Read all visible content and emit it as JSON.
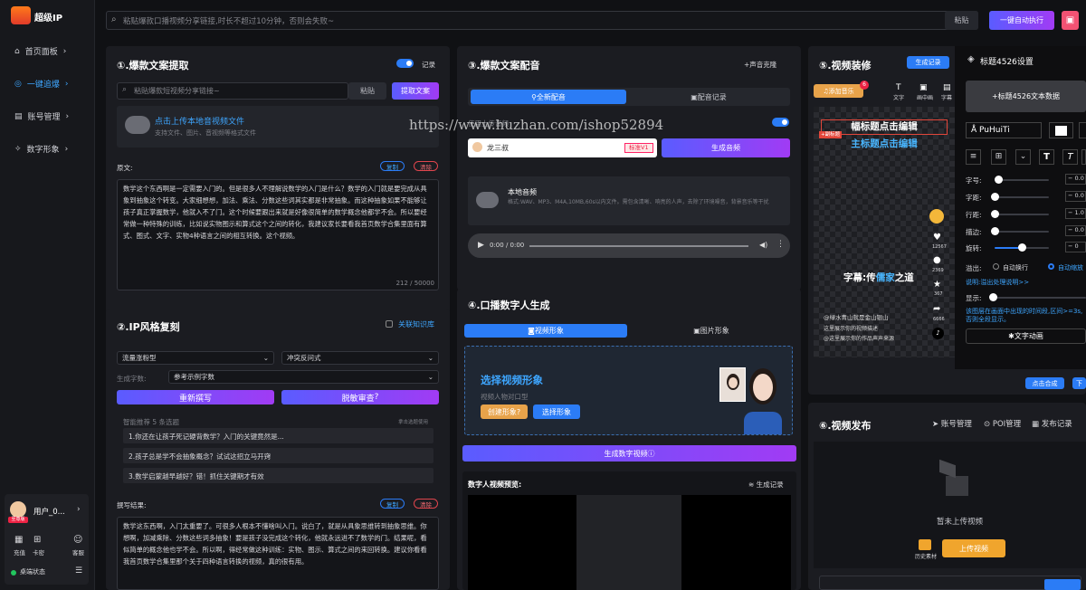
{
  "app": {
    "name": "超级IP"
  },
  "sidebar": {
    "items": [
      {
        "label": "首页面板"
      },
      {
        "label": "一键追爆"
      },
      {
        "label": "账号管理"
      },
      {
        "label": "数字形象"
      }
    ],
    "user": {
      "name": "用户_0...",
      "badge": "至尊版"
    },
    "quick": [
      {
        "label": "充值"
      },
      {
        "label": "卡密"
      },
      {
        "label": "客服"
      }
    ],
    "status": "桌端状态"
  },
  "topbar": {
    "placeholder": "粘贴爆款口播视频分享链接,时长不超过10分钟，否则会失败~",
    "paste": "粘贴",
    "run": "一键自动执行"
  },
  "p1": {
    "title": "①.爆款文案提取",
    "record": "记录",
    "link_placeholder": "粘贴爆款短视频分享链接~",
    "paste": "粘贴",
    "extract": "提取文案",
    "upload": "点击上传本地音视频文件",
    "upload_hint": "支持文件、图片、音视频等格式文件",
    "orig_label": "原文:",
    "copy": "复制",
    "clear": "清除",
    "orig_text": "数学这个东西啊是一定需要入门的。但是很多人不理解说数学的入门是什么？数学的入门就是要完成从具象到抽象这个转变。大家细想想，加法、乘法、分数这些词其实都是非常抽象。而这种抽象如果不能够让孩子真正掌握数学，他就入不了门。这个时候要跟出来就是好像很简单的数学概念他都学不会。所以要经常做一种特殊的训练，比如说实物图示和算式这个之间的转化，我建议家长要看我首页数学合集里面有算式、图式、文字、实物4种语言之间的相互转换。这个视频。",
    "count": "212 / 50000"
  },
  "p2": {
    "title": "②.IP风格复刻",
    "kb": "关联知识库",
    "style1": "流量涨粉型",
    "style2": "冲突反问式",
    "wc_label": "生成字数:",
    "wc_value": "参考示例字数",
    "rewrite": "重新撰写",
    "check": "脱敏审查",
    "rec_label": "智能推荐 5 条选题",
    "rec_hint": "拿击选题使用",
    "topics": [
      "1.你还在让孩子死记硬背数学？入门的关键竟然是...",
      "2.孩子总是学不会抽象概念？试试这招立马开窍",
      "3.数学启蒙越早越好？错！抓住关键期才有效"
    ],
    "result_label": "撰写结果:",
    "copy": "复制",
    "clear": "清除",
    "result_text": "数学这东西啊，入门太重要了。可很多人根本不懂啥叫入门。说白了，就是从具象思维转到抽象思维。你想啊，加减乘除、分数这些词多抽象！要是孩子没完成这个转化，他就永远进不了数学的门。结果呢，看似简单的概念他也学不会。所以啊，得经常做这种训练：实物、图示、算式之间的来回转换。建议你看看我首页数学合集里那个关于四种语言转换的视频，真的很有用。"
  },
  "p3": {
    "title": "③.爆款文案配音",
    "clone": "+声音克隆",
    "tab1": "全新配音",
    "tab2": "配音记录",
    "auto_label": "使用上传音频",
    "voice": "龙三叔",
    "voice_tag": "标准V1",
    "gen": "生成音频",
    "local": "本地音频",
    "local_hint": "格式:WAV、MP3、M4A,10MB,60s以内文件。需包含清晰、响亮的人声，去除了环境噪音，背景音乐等干扰",
    "time": "0:00 / 0:00"
  },
  "p4": {
    "title": "④.口播数字人生成",
    "tab1": "视频形象",
    "tab2": "图片形象",
    "select_title": "选择视频形象",
    "select_sub": "视频人物对口型",
    "create": "创建形象",
    "pick": "选择形象",
    "gen": "生成数字视频",
    "preview": "数字人视频预览:",
    "records": "生成记录"
  },
  "p5": {
    "title": "⑤.视频装修",
    "records": "生成记录",
    "music": "添加音乐",
    "music_badge": "6",
    "tools": [
      "文字",
      "画中画",
      "字幕"
    ],
    "title1": "幅标题点击编辑",
    "title2": "主标题点击编辑",
    "sub_tag": "+副标题",
    "caption_prefix": "字幕:传",
    "caption_hl": "儒家",
    "caption_suffix": "之道",
    "desc": [
      "@绿水青山就是金山银山",
      "这里展示你的视频描述",
      "@这里展示你的作品声声来源"
    ],
    "likes": "12567",
    "comments": "2369",
    "stars": "367",
    "shares": "6666",
    "compose": "点击合成",
    "next": "下"
  },
  "settings": {
    "title": "标题4526设置",
    "add": "+标题4526文本数据",
    "font": "PuHuiTi",
    "rows": [
      {
        "label": "字号:",
        "v": "0.0"
      },
      {
        "label": "字距:",
        "v": "0.0"
      },
      {
        "label": "行距:",
        "v": "1.0"
      },
      {
        "label": "描边:",
        "v": "0.0"
      },
      {
        "label": "旋转:",
        "v": "0"
      }
    ],
    "overflow": "溢出:",
    "wrap": "自动换行",
    "shrink": "自动缩放",
    "explain": "说明:溢出处理说明>>",
    "show": "显示:",
    "note": "该图层在画面中出现的时间段,区间>=3s,否则全段显示。",
    "anim": "文字动画"
  },
  "p6": {
    "title": "⑥.视频发布",
    "account": "账号管理",
    "poi": "POI管理",
    "pub": "发布记录",
    "empty": "暂未上传视频",
    "history": "历史素材",
    "upload": "上传视频"
  },
  "watermark": "https://www.huzhan.com/ishop52894"
}
